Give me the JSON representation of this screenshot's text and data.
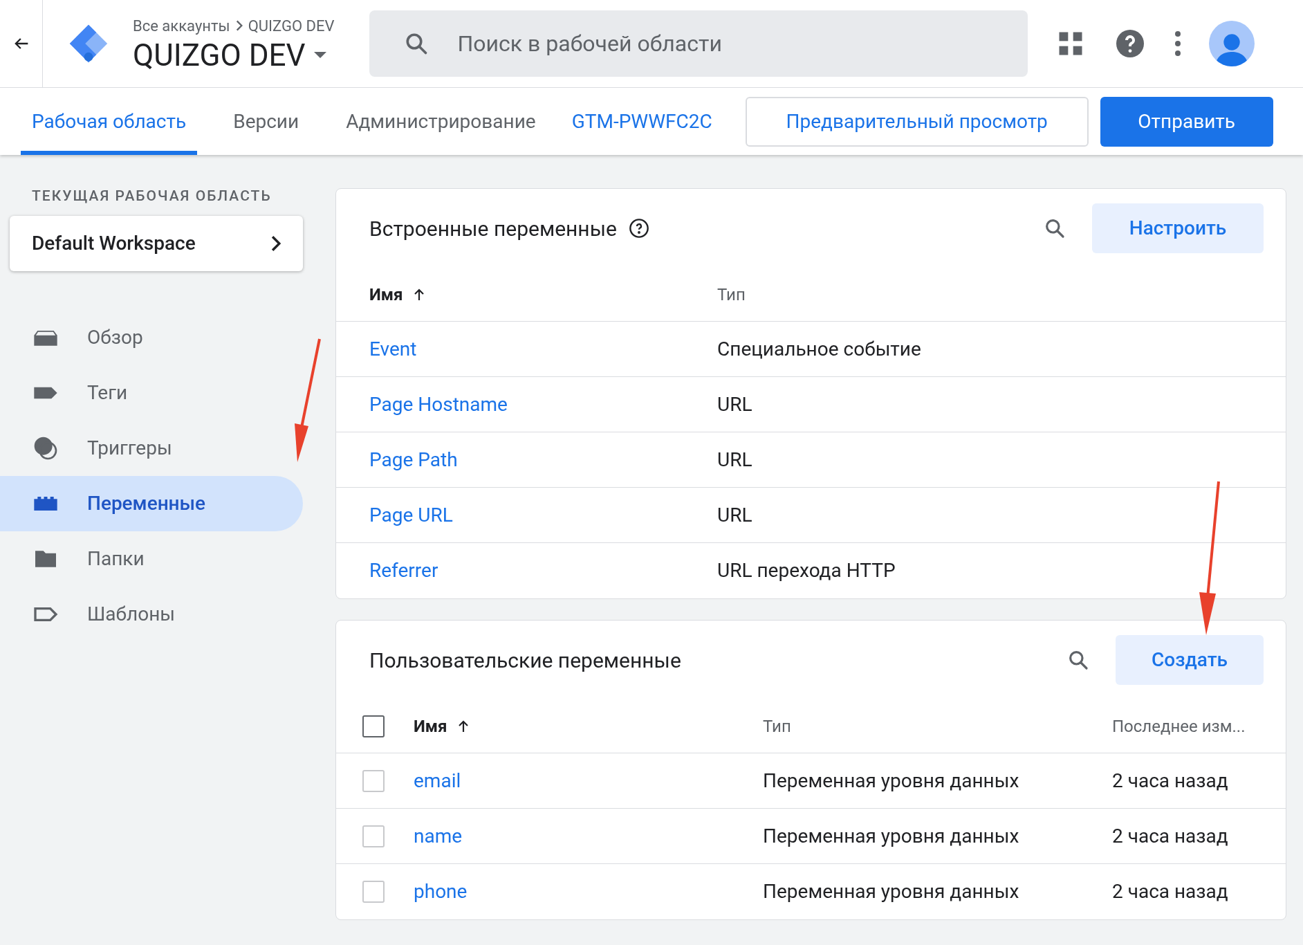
{
  "header": {
    "breadcrumb": {
      "parent": "Все аккаунты",
      "current": "QUIZGO DEV"
    },
    "container": "QUIZGO DEV",
    "search": {
      "placeholder": "Поиск в рабочей области"
    }
  },
  "tabs": [
    {
      "label": "Рабочая область",
      "selected": true
    },
    {
      "label": "Версии",
      "selected": false
    },
    {
      "label": "Администрирование",
      "selected": false
    }
  ],
  "container_id": "GTM-PWWFC2C",
  "buttons": {
    "preview": "Предварительный просмотр",
    "submit": "Отправить"
  },
  "sidebar": {
    "section_label": "ТЕКУЩАЯ РАБОЧАЯ ОБЛАСТЬ",
    "workspace": "Default Workspace",
    "items": [
      {
        "label": "Обзор",
        "selected": false
      },
      {
        "label": "Теги",
        "selected": false
      },
      {
        "label": "Триггеры",
        "selected": false
      },
      {
        "label": "Переменные",
        "selected": true
      },
      {
        "label": "Папки",
        "selected": false
      },
      {
        "label": "Шаблоны",
        "selected": false
      }
    ]
  },
  "builtin": {
    "title": "Встроенные переменные",
    "button": "Настроить",
    "columns": [
      "Имя",
      "Тип"
    ],
    "rows": [
      {
        "name": "Event",
        "type": "Специальное событие"
      },
      {
        "name": "Page Hostname",
        "type": "URL"
      },
      {
        "name": "Page Path",
        "type": "URL"
      },
      {
        "name": "Page URL",
        "type": "URL"
      },
      {
        "name": "Referrer",
        "type": "URL перехода HTTP"
      }
    ]
  },
  "custom": {
    "title": "Пользовательские переменные",
    "button": "Создать",
    "header_checked": false,
    "columns": [
      "Имя",
      "Тип",
      "Последнее изм..."
    ],
    "rows": [
      {
        "checked": false,
        "name": "email",
        "type": "Переменная уровня данных",
        "modified": "2 часа назад"
      },
      {
        "checked": false,
        "name": "name",
        "type": "Переменная уровня данных",
        "modified": "2 часа назад"
      },
      {
        "checked": false,
        "name": "phone",
        "type": "Переменная уровня данных",
        "modified": "2 часа назад"
      }
    ]
  }
}
